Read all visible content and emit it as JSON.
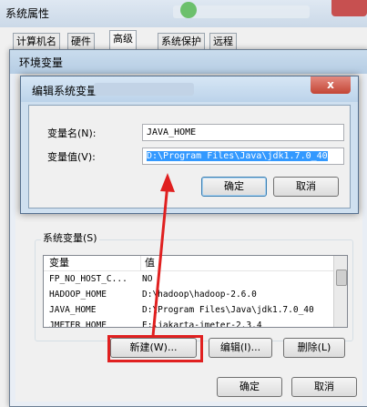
{
  "outer_window": {
    "title": "系统属性",
    "tabs": [
      "计算机名",
      "硬件",
      "高级",
      "系统保护",
      "远程"
    ],
    "active_tab": "高级",
    "ok_label": "确定",
    "cancel_label": "取消"
  },
  "env_window": {
    "title": "环境变量"
  },
  "edit_dialog": {
    "title": "编辑系统变量",
    "close_glyph": "x",
    "name_label": "变量名(N):",
    "name_value": "JAVA_HOME",
    "value_label": "变量值(V):",
    "value_value": "D:\\Program Files\\Java\\jdk1.7.0_40",
    "ok_label": "确定",
    "cancel_label": "取消"
  },
  "system_vars": {
    "group_label": "系统变量(S)",
    "columns": [
      "变量",
      "值"
    ],
    "rows": [
      {
        "name": "FP_NO_HOST_C...",
        "value": "NO"
      },
      {
        "name": "HADOOP_HOME",
        "value": "D:\\hadoop\\hadoop-2.6.0"
      },
      {
        "name": "JAVA_HOME",
        "value": "D:\\Program Files\\Java\\jdk1.7.0_40"
      },
      {
        "name": "JMETER_HOME",
        "value": "E:\\jakarta-jmeter-2.3.4"
      }
    ],
    "new_label": "新建(W)...",
    "edit_label": "编辑(I)...",
    "delete_label": "删除(L)"
  },
  "env_buttons": {
    "ok_label": "确定",
    "cancel_label": "取消"
  },
  "colors": {
    "annotation_red": "#e02020",
    "selection_blue": "#3399ff"
  }
}
